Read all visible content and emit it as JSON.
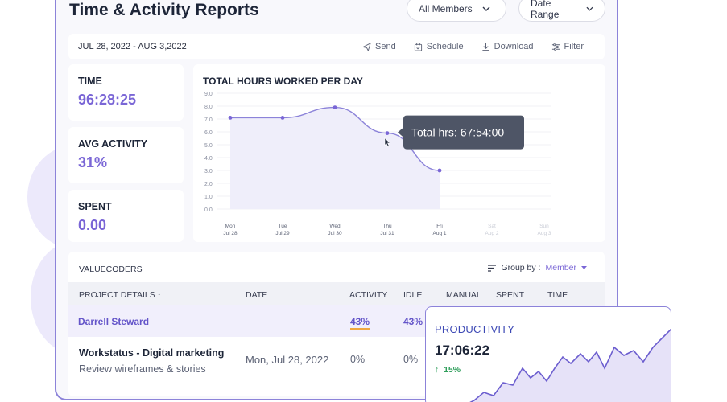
{
  "header": {
    "title": "Time & Activity Reports",
    "members_filter": "All Members",
    "date_filter": "Date Range"
  },
  "toolbar": {
    "date_range": "JUL 28, 2022 - AUG 3,2022",
    "send": "Send",
    "schedule": "Schedule",
    "download": "Download",
    "filter": "Filter"
  },
  "stats": [
    {
      "label": "TIME",
      "value": "96:28:25"
    },
    {
      "label": "AVG ACTIVITY",
      "value": "31%"
    },
    {
      "label": "SPENT",
      "value": "0.00"
    }
  ],
  "chart": {
    "title": "TOTAL HOURS WORKED PER DAY",
    "tooltip": "Total hrs: 67:54:00"
  },
  "chart_data": {
    "type": "line",
    "title": "TOTAL HOURS WORKED PER DAY",
    "y_ticks": [
      "9.0",
      "8.0",
      "7.0",
      "6.0",
      "5.0",
      "4.0",
      "3.0",
      "2.0",
      "1.0",
      "0.0"
    ],
    "categories": [
      {
        "day": "Mon",
        "date": "Jul 28"
      },
      {
        "day": "Tue",
        "date": "Jul 29"
      },
      {
        "day": "Wed",
        "date": "Jul 30"
      },
      {
        "day": "Thu",
        "date": "Jul 31"
      },
      {
        "day": "Fri",
        "date": "Aug 1"
      },
      {
        "day": "Sat",
        "date": "Aug 2"
      },
      {
        "day": "Sun",
        "date": "Aug 3"
      }
    ],
    "values": [
      7.1,
      7.1,
      7.9,
      5.9,
      3.0
    ],
    "ylim": [
      0,
      9
    ],
    "grid": true,
    "colors": {
      "line": "#8c83d9",
      "fill": "#efeefa"
    }
  },
  "table": {
    "company": "VALUECODERS",
    "group_by_label": "Group by :",
    "group_by_value": "Member",
    "columns": [
      "PROJECT DETAILS",
      "DATE",
      "ACTIVITY",
      "IDLE",
      "MANUAL",
      "SPENT",
      "TIME"
    ],
    "rows": [
      {
        "name": "Darrell Steward",
        "activity": "43%",
        "idle": "43%"
      },
      {
        "name": "Workstatus - Digital marketing",
        "sub": "Review wireframes & stories",
        "date": "Mon, Jul 28, 2022",
        "activity": "0%",
        "idle": "0%"
      }
    ]
  },
  "productivity": {
    "title": "PRODUCTIVITY",
    "value": "17:06:22",
    "change": "15%",
    "colors": {
      "accent": "#7a66d6",
      "up": "#2f9e5b"
    }
  }
}
